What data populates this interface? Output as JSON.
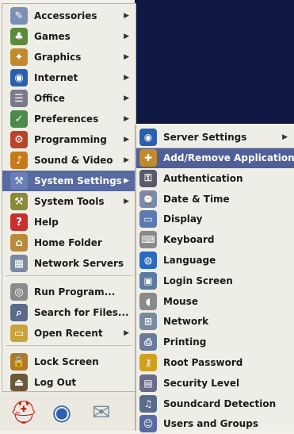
{
  "main_menu": {
    "items": [
      {
        "label": "Accessories",
        "icon": "accessories-icon",
        "color": "#7b8fb5",
        "symbol": "✎"
      },
      {
        "label": "Games",
        "icon": "games-icon",
        "color": "#5a8a3a",
        "symbol": "♣"
      },
      {
        "label": "Graphics",
        "icon": "graphics-icon",
        "color": "#c28a2a",
        "symbol": "✦"
      },
      {
        "label": "Internet",
        "icon": "internet-icon",
        "color": "#2a5fb0",
        "symbol": "◉"
      },
      {
        "label": "Office",
        "icon": "office-icon",
        "color": "#7a7a8a",
        "symbol": "☰"
      },
      {
        "label": "Preferences",
        "icon": "preferences-icon",
        "color": "#4e8a4a",
        "symbol": "✓"
      },
      {
        "label": "Programming",
        "icon": "programming-icon",
        "color": "#b8452a",
        "symbol": "⚙"
      },
      {
        "label": "Sound & Video",
        "icon": "sound-video-icon",
        "color": "#c87a1a",
        "symbol": "♪"
      },
      {
        "label": "System Settings",
        "icon": "system-settings-icon",
        "color": "#6a7fb8",
        "symbol": "⚒",
        "selected": true
      },
      {
        "label": "System Tools",
        "icon": "system-tools-icon",
        "color": "#8a8a3a",
        "symbol": "⚒"
      },
      {
        "label": "Help",
        "icon": "help-icon",
        "color": "#c83030",
        "symbol": "?"
      },
      {
        "label": "Home Folder",
        "icon": "home-folder-icon",
        "color": "#b88a3a",
        "symbol": "⌂"
      },
      {
        "label": "Network Servers",
        "icon": "network-servers-icon",
        "color": "#7a8aa0",
        "symbol": "▦"
      },
      {
        "label": "Run Program...",
        "icon": "run-program-icon",
        "color": "#8a8a8a",
        "symbol": "◎"
      },
      {
        "label": "Search for Files...",
        "icon": "search-files-icon",
        "color": "#5a6a8a",
        "symbol": "⌕"
      },
      {
        "label": "Open Recent",
        "icon": "open-recent-icon",
        "color": "#c8a23a",
        "symbol": "▭"
      },
      {
        "label": "Lock Screen",
        "icon": "lock-screen-icon",
        "color": "#b07a2a",
        "symbol": "🔒"
      },
      {
        "label": "Log Out",
        "icon": "log-out-icon",
        "color": "#6a5a3a",
        "symbol": "⏏"
      }
    ]
  },
  "submenu": {
    "items": [
      {
        "label": "Server Settings",
        "icon": "server-settings-icon",
        "color": "#2a5fb0",
        "symbol": "◉",
        "arrow": true
      },
      {
        "label": "Add/Remove Applications",
        "icon": "add-remove-icon",
        "color": "#c28a2a",
        "symbol": "✚",
        "selected": true
      },
      {
        "label": "Authentication",
        "icon": "authentication-icon",
        "color": "#5a5a6a",
        "symbol": "⚿"
      },
      {
        "label": "Date & Time",
        "icon": "date-time-icon",
        "color": "#7a8ab0",
        "symbol": "⌚"
      },
      {
        "label": "Display",
        "icon": "display-icon",
        "color": "#5a7ab0",
        "symbol": "▭"
      },
      {
        "label": "Keyboard",
        "icon": "keyboard-icon",
        "color": "#8a8a8a",
        "symbol": "⌨"
      },
      {
        "label": "Language",
        "icon": "language-icon",
        "color": "#2a6ac0",
        "symbol": "◍"
      },
      {
        "label": "Login Screen",
        "icon": "login-screen-icon",
        "color": "#5a7aa0",
        "symbol": "▣"
      },
      {
        "label": "Mouse",
        "icon": "mouse-icon",
        "color": "#8a8a8a",
        "symbol": "◖"
      },
      {
        "label": "Network",
        "icon": "network-icon",
        "color": "#7a8aa0",
        "symbol": "⊞"
      },
      {
        "label": "Printing",
        "icon": "printing-icon",
        "color": "#6a7a9a",
        "symbol": "⎙"
      },
      {
        "label": "Root Password",
        "icon": "root-password-icon",
        "color": "#d0a020",
        "symbol": "⚷"
      },
      {
        "label": "Security Level",
        "icon": "security-level-icon",
        "color": "#6a6a8a",
        "symbol": "▤"
      },
      {
        "label": "Soundcard Detection",
        "icon": "soundcard-icon",
        "color": "#5a6a8a",
        "symbol": "♫"
      },
      {
        "label": "Users and Groups",
        "icon": "users-groups-icon",
        "color": "#5a6aa0",
        "symbol": "☺"
      }
    ]
  },
  "launchers": [
    {
      "name": "redhat-menu-icon",
      "symbol": "⛑",
      "color": "#c0201a"
    },
    {
      "name": "web-browser-icon",
      "symbol": "◉",
      "color": "#2a5fb0"
    },
    {
      "name": "email-icon",
      "symbol": "✉",
      "color": "#7a8a9a"
    }
  ]
}
